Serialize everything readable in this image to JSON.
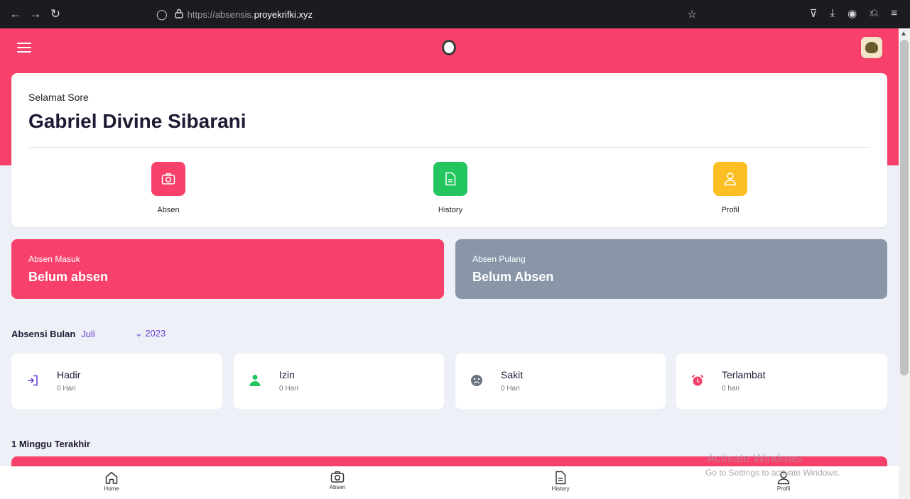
{
  "browser": {
    "url_prefix": "https://absensis.",
    "url_domain": "proyekrifki.xyz"
  },
  "greeting": {
    "salutation": "Selamat Sore",
    "name": "Gabriel Divine Sibarani"
  },
  "quick_actions": [
    {
      "label": "Absen",
      "icon": "camera-icon",
      "color": "#f7416b"
    },
    {
      "label": "History",
      "icon": "document-icon",
      "color": "#22c55e"
    },
    {
      "label": "Profil",
      "icon": "user-icon",
      "color": "#fbbf24"
    }
  ],
  "status": {
    "in": {
      "label": "Absen Masuk",
      "value": "Belum absen"
    },
    "out": {
      "label": "Absen Pulang",
      "value": "Belum Absen"
    }
  },
  "monthly": {
    "label": "Absensi Bulan",
    "month": "Juli",
    "year": "2023",
    "year_prefix": "⌄ "
  },
  "stats": [
    {
      "title": "Hadir",
      "value": "0 Hari",
      "icon": "login-icon",
      "color": "#6d3fd1"
    },
    {
      "title": "Izin",
      "value": "0 Hari",
      "icon": "person-icon",
      "color": "#22c55e"
    },
    {
      "title": "Sakit",
      "value": "0 Hari",
      "icon": "sad-face-icon",
      "color": "#6b7280"
    },
    {
      "title": "Terlambat",
      "value": "0 hari",
      "icon": "alarm-icon",
      "color": "#f7416b"
    }
  ],
  "week": {
    "title": "1 Minggu Terakhir"
  },
  "watermark": {
    "title": "Activate Windows",
    "subtitle": "Go to Settings to activate Windows."
  },
  "bottom_nav": [
    {
      "label": "Home",
      "icon": "home-icon"
    },
    {
      "label": "Absen",
      "icon": "camera-icon"
    },
    {
      "label": "History",
      "icon": "document-icon"
    },
    {
      "label": "Profil",
      "icon": "user-icon"
    }
  ]
}
